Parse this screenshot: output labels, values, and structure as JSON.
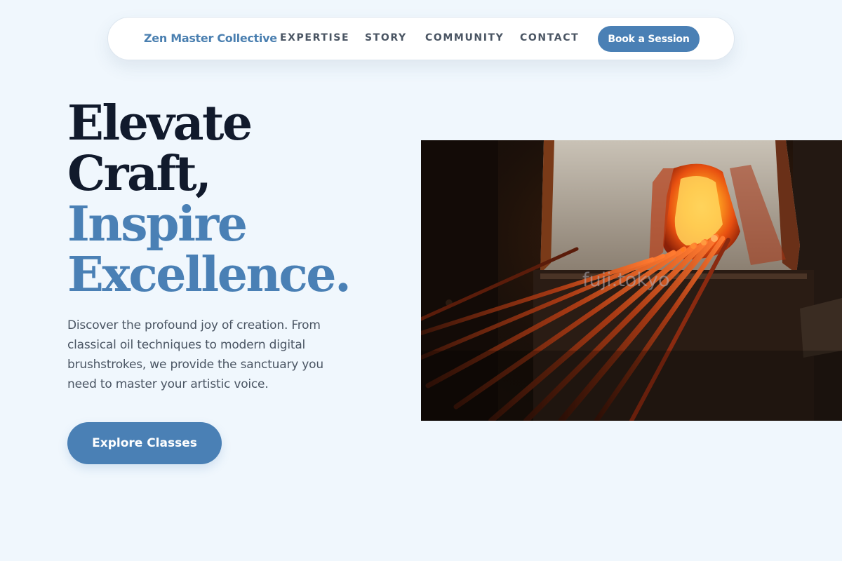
{
  "nav": {
    "brand": "Zen Master Collective",
    "links": [
      "EXPERTISE",
      "STORY",
      "COMMUNITY",
      "CONTACT"
    ],
    "cta_label": "Book a Session"
  },
  "hero": {
    "headline_line1": "Elevate",
    "headline_line2": "Craft,",
    "headline_line3": "Inspire",
    "headline_line4": "Excellence.",
    "description": "Discover the profound joy of creation. From classical oil techniques to modern digital brushstrokes, we provide the sanctuary you need to master your artistic voice.",
    "cta_label": "Explore Classes",
    "image_watermark": "fuji.tokyo"
  },
  "colors": {
    "background": "#f0f7fd",
    "accent": "#4a80b5",
    "heading_dark": "#111a2c",
    "body_text": "#4a5563"
  }
}
